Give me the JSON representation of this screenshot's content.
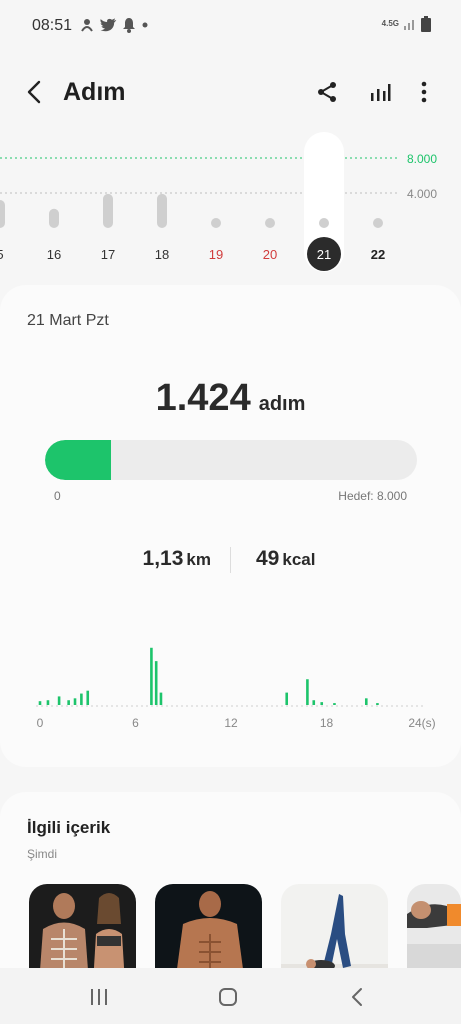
{
  "status_bar": {
    "time": "08:51",
    "network": "4.5G",
    "icons": [
      "gesture-icon",
      "twitter-icon",
      "notification-bell-icon",
      "dot-icon",
      "signal-icon",
      "battery-icon"
    ]
  },
  "header": {
    "title": "Adım",
    "icons": [
      "back-icon",
      "share-icon",
      "chart-icon",
      "more-icon"
    ]
  },
  "week_chart": {
    "y_labels": [
      "8.000",
      "4.000"
    ],
    "days": [
      "5",
      "16",
      "17",
      "18",
      "19",
      "20",
      "21",
      "22"
    ],
    "values": [
      3200,
      2200,
      3900,
      3900,
      1600,
      1150,
      1424,
      800
    ],
    "day_colors": [
      "#333333",
      "#333333",
      "#333333",
      "#333333",
      "#d13c3c",
      "#d13c3c",
      "#ffffff",
      "#222222"
    ],
    "selected_index": 6,
    "goal": 8000,
    "goal_color": "#1dc46b"
  },
  "day_detail": {
    "date": "21 Mart Pzt",
    "steps_value": "1.424",
    "steps_unit": "adım",
    "progress_fraction": 0.178,
    "progress_min_label": "0",
    "progress_goal_label": "Hedef: 8.000",
    "distance_value": "1,13",
    "distance_unit": "km",
    "calories_value": "49",
    "calories_unit": "kcal",
    "accent_color": "#1dc46b"
  },
  "chart_data": {
    "type": "bar",
    "x_tick_labels": [
      "0",
      "6",
      "12",
      "18",
      "24(s)"
    ],
    "x_domain": [
      0,
      24
    ],
    "values_x": [
      0,
      0.5,
      1.2,
      1.8,
      2.2,
      2.6,
      3.0,
      7.0,
      7.3,
      7.6,
      15.5,
      16.8,
      17.2,
      17.7,
      18.5,
      20.5,
      21.2
    ],
    "values_y": [
      4,
      5,
      9,
      5,
      7,
      12,
      15,
      60,
      46,
      13,
      13,
      27,
      5,
      3,
      2,
      7,
      2
    ],
    "ylim": [
      0,
      65
    ]
  },
  "related": {
    "title": "İlgili içerik",
    "subtitle": "Şimdi"
  },
  "navbar": {
    "icons": [
      "recent-apps-icon",
      "home-icon",
      "back-nav-icon"
    ]
  }
}
